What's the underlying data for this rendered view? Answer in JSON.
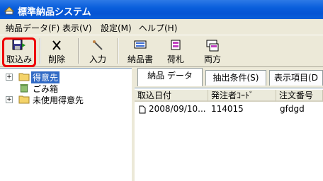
{
  "window": {
    "title": "標準納品システム"
  },
  "menu": [
    {
      "label": "納品データ(F)"
    },
    {
      "label": "表示(V)"
    },
    {
      "label": "設定(M)"
    },
    {
      "label": "ヘルプ(H)"
    }
  ],
  "toolbar": {
    "import_label": "取込み",
    "delete_label": "削除",
    "input_label": "入力",
    "delivery_note_label": "納品書",
    "tag_label": "荷札",
    "both_label": "両方"
  },
  "tree": {
    "items": [
      {
        "label": "得意先",
        "expander": "+"
      },
      {
        "label": "ごみ箱"
      },
      {
        "label": "未使用得意先",
        "expander": "+"
      }
    ]
  },
  "tabs": [
    {
      "label": "納品 データ"
    },
    {
      "label": "抽出条件(S)"
    },
    {
      "label": "表示項目(D"
    }
  ],
  "table": {
    "columns": [
      "取込日付",
      "発注者ｺｰﾄﾞ",
      "注文番号"
    ],
    "rows": [
      {
        "date": "2008/09/10...",
        "orderer_code": "114015",
        "order_no": "gfdgd"
      }
    ]
  },
  "colors": {
    "title_bar": "#0a5fdc",
    "selection": "#316ac5",
    "highlight": "#e00000"
  }
}
